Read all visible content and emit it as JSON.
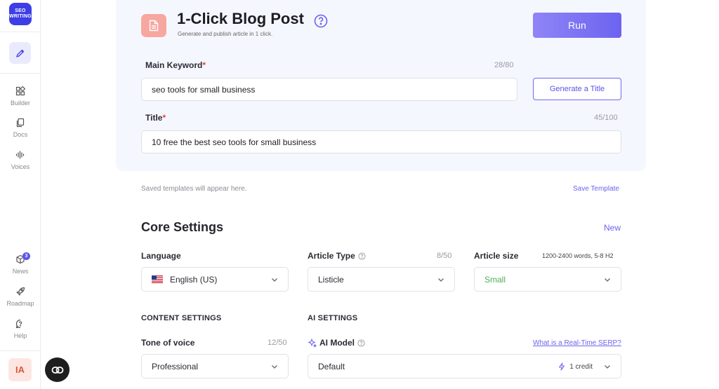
{
  "sidebar": {
    "logo_text": "SEO WRITING",
    "items": [
      {
        "label": "Builder",
        "icon": "builder-icon"
      },
      {
        "label": "Docs",
        "icon": "docs-icon"
      },
      {
        "label": "Voices",
        "icon": "voices-icon"
      },
      {
        "label": "News",
        "icon": "news-icon",
        "badge": "3"
      },
      {
        "label": "Roadmap",
        "icon": "rocket-icon"
      },
      {
        "label": "Help",
        "icon": "help-chat-icon"
      }
    ],
    "avatar_initials": "IA"
  },
  "header": {
    "title": "1-Click Blog Post",
    "subtitle": "Generate and publish article in 1 click.",
    "run_label": "Run"
  },
  "main_keyword": {
    "label": "Main Keyword",
    "required_mark": "*",
    "counter": "28/80",
    "value": "seo tools for small business",
    "generate_label": "Generate a Title"
  },
  "title_field": {
    "label": "Title",
    "required_mark": "*",
    "counter": "45/100",
    "value": "10 free the best seo tools for small business"
  },
  "templates": {
    "hint": "Saved templates will appear here.",
    "save_label": "Save Template"
  },
  "core_settings": {
    "title": "Core Settings",
    "new_label": "New",
    "language": {
      "label": "Language",
      "value": "English (US)"
    },
    "article_type": {
      "label": "Article Type",
      "counter": "8/50",
      "value": "Listicle"
    },
    "article_size": {
      "label": "Article size",
      "note": "1200-2400 words, 5-8 H2",
      "value": "Small"
    }
  },
  "content_settings": {
    "title": "CONTENT SETTINGS",
    "tone": {
      "label": "Tone of voice",
      "counter": "12/50",
      "value": "Professional"
    }
  },
  "ai_settings": {
    "title": "AI SETTINGS",
    "model_label": "AI Model",
    "serp_link": "What is a Real-Time SERP?",
    "model_value": "Default",
    "credit_label": "1 credit"
  },
  "colors": {
    "accent": "#6b63ec",
    "required": "#e1453e",
    "small_green": "#4caf50"
  }
}
